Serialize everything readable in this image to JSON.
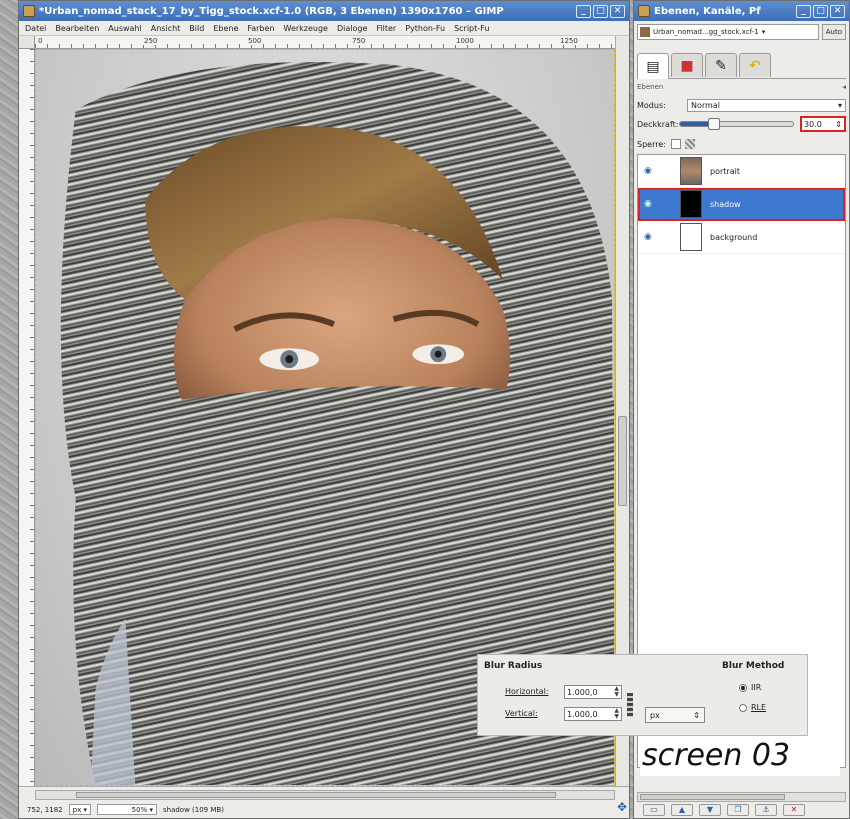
{
  "image_window": {
    "title": "*Urban_nomad_stack_17_by_Tigg_stock.xcf-1.0 (RGB, 3 Ebenen) 1390x1760 – GIMP",
    "menu": [
      "Datei",
      "Bearbeiten",
      "Auswahl",
      "Ansicht",
      "Bild",
      "Ebene",
      "Farben",
      "Werkzeuge",
      "Dialoge",
      "Filter",
      "Python-Fu",
      "Script-Fu"
    ],
    "ruler_labels": [
      "0",
      "250",
      "500",
      "750",
      "1000",
      "1250"
    ],
    "status": {
      "coords": "752, 1182",
      "unit": "px",
      "zoom": "50%",
      "info": "shadow (109 MB)"
    }
  },
  "dock": {
    "title": "Ebenen, Kanäle, Pf",
    "image_combo": "Urban_nomad...gg_stock.xcf-1",
    "auto_label": "Auto",
    "section_label": "Ebenen",
    "mode_label": "Modus:",
    "mode_value": "Normal",
    "opacity_label": "Deckkraft:",
    "opacity_value": "30.0",
    "opacity_level": 0.3,
    "lock_label": "Sperre:",
    "layers": [
      {
        "name": "portrait"
      },
      {
        "name": "shadow"
      },
      {
        "name": "background"
      }
    ]
  },
  "blur_dialog": {
    "radius_heading": "Blur Radius",
    "method_heading": "Blur Method",
    "horizontal_label": "Horizontal:",
    "horizontal_value": "1.000,0",
    "vertical_label": "Vertical:",
    "vertical_value": "1.000,0",
    "unit": "px",
    "method_options": [
      {
        "label": "IIR",
        "selected": true
      },
      {
        "label": "RLE",
        "selected": false
      }
    ]
  },
  "caption": "screen 03",
  "colors": {
    "title_blue": "#3c6db8",
    "selection_blue": "#3d79cf",
    "highlight_red": "#dd2222"
  }
}
